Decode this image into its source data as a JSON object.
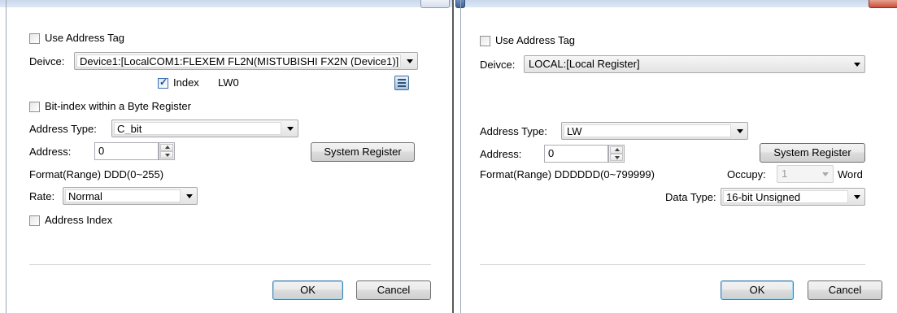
{
  "left_dialog": {
    "use_address_tag": {
      "label": "Use Address Tag",
      "checked": false
    },
    "device": {
      "label": "Deivce:",
      "value": "Device1:[LocalCOM1:FLEXEM FL2N(MISTUBISHI FX2N (Device1)]"
    },
    "index": {
      "label": "Index",
      "checked": true,
      "value": "LW0"
    },
    "bit_index": {
      "label": "Bit-index within a Byte Register",
      "checked": false
    },
    "address_type": {
      "label": "Address Type:",
      "value": "C_bit"
    },
    "address": {
      "label": "Address:",
      "value": "0"
    },
    "system_register_label": "System Register",
    "format_range": "Format(Range)  DDD(0~255)",
    "rate": {
      "label": "Rate:",
      "value": "Normal"
    },
    "address_index": {
      "label": "Address Index",
      "checked": false
    },
    "ok_label": "OK",
    "cancel_label": "Cancel"
  },
  "right_dialog": {
    "use_address_tag": {
      "label": "Use Address Tag",
      "checked": false
    },
    "device": {
      "label": "Deivce:",
      "value": "LOCAL:[Local Register]"
    },
    "address_type": {
      "label": "Address Type:",
      "value": "LW"
    },
    "address": {
      "label": "Address:",
      "value": "0"
    },
    "system_register_label": "System Register",
    "format_range": "Format(Range)  DDDDDD(0~799999)",
    "occupy": {
      "label": "Occupy:",
      "value": "1",
      "unit": "Word"
    },
    "data_type": {
      "label": "Data Type:",
      "value": "16-bit Unsigned"
    },
    "ok_label": "OK",
    "cancel_label": "Cancel"
  },
  "colors": {
    "title_bar": "#c9d8ec",
    "default_button_border": "#3c7fb1",
    "close_button": "#c8503a"
  }
}
